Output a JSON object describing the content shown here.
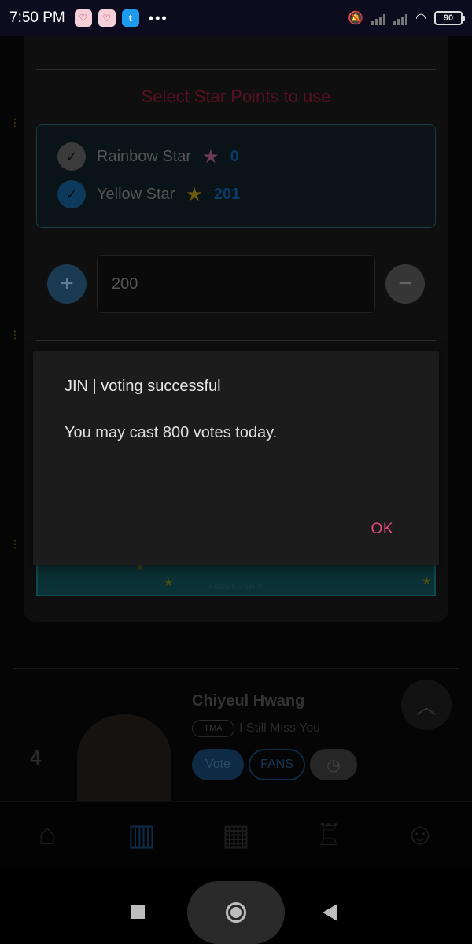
{
  "status_bar": {
    "time": "7:50 PM",
    "more": "•••",
    "battery": "90"
  },
  "vote_sheet": {
    "select_title": "Select Star Points to use",
    "stars": [
      {
        "label": "Rainbow Star",
        "count": "0",
        "checked": false
      },
      {
        "label": "Yellow Star",
        "count": "201",
        "checked": true
      }
    ],
    "amount_value": "200",
    "banner_brand": "FANBERSHIP"
  },
  "ranking_row": {
    "rank": "4",
    "artist": "Chiyeul Hwang",
    "badge": "TMA",
    "song": "I Still Miss You",
    "vote_label": "Vote",
    "fans_label": "FANS"
  },
  "dialog": {
    "title": "JIN | voting successful",
    "message": "You may cast 800 votes today.",
    "ok_label": "OK"
  },
  "colors": {
    "accent_pink": "#e5487a",
    "dialog_bg": "#1c1c1c"
  },
  "icons": {
    "plus": "plus-icon",
    "minus": "minus-icon",
    "check": "check-icon",
    "rainbow_star": "rainbow-star-icon",
    "yellow_star": "yellow-star-icon",
    "chevron_up": "chevron-up-icon",
    "home": "home-icon",
    "chart": "chart-icon",
    "calendar": "calendar-icon",
    "trophy": "trophy-icon",
    "emoji": "emoji-icon"
  }
}
